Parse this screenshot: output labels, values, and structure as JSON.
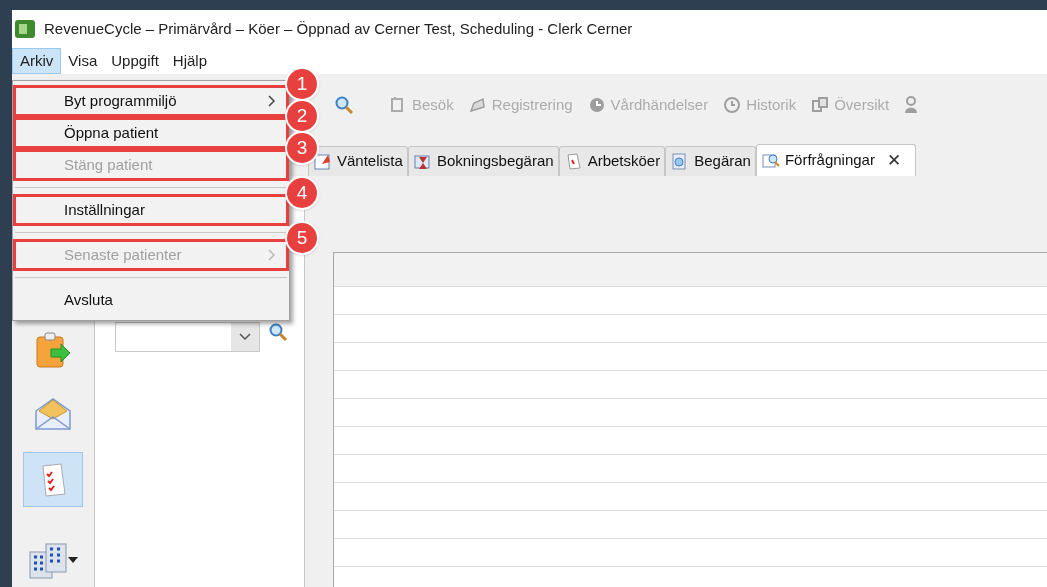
{
  "window": {
    "title": "RevenueCycle – Primärvård – Köer – Öppnad av Cerner Test, Scheduling - Clerk Cerner"
  },
  "menu_bar": [
    {
      "label": "Arkiv",
      "selected": true
    },
    {
      "label": "Visa",
      "selected": false
    },
    {
      "label": "Uppgift",
      "selected": false
    },
    {
      "label": "Hjälp",
      "selected": false
    }
  ],
  "file_menu": [
    {
      "kind": "item",
      "label": "Byt programmiljö",
      "disabled": false,
      "submenu": true,
      "callout": "1"
    },
    {
      "kind": "item",
      "label": "Öppna patient",
      "disabled": false,
      "submenu": false,
      "callout": "2"
    },
    {
      "kind": "item",
      "label": "Stäng patient",
      "disabled": true,
      "submenu": false,
      "callout": "3"
    },
    {
      "kind": "separator"
    },
    {
      "kind": "item",
      "label": "Inställningar",
      "disabled": false,
      "submenu": false,
      "callout": "4"
    },
    {
      "kind": "separator"
    },
    {
      "kind": "item",
      "label": "Senaste patienter",
      "disabled": true,
      "submenu": true,
      "callout": "5"
    },
    {
      "kind": "separator"
    },
    {
      "kind": "item",
      "label": "Avsluta",
      "disabled": false,
      "submenu": false
    }
  ],
  "toolbar": [
    {
      "kind": "visit",
      "label": "Besök",
      "disabled": true
    },
    {
      "kind": "register",
      "label": "Registrering",
      "disabled": true
    },
    {
      "kind": "events",
      "label": "Vårdhändelser",
      "disabled": true
    },
    {
      "kind": "history",
      "label": "Historik",
      "disabled": true
    },
    {
      "kind": "overview",
      "label": "Översikt",
      "disabled": true
    },
    {
      "kind": "person",
      "disabled": true
    }
  ],
  "tabs": [
    {
      "label": "Väntelista",
      "selected": false,
      "closable": false
    },
    {
      "label": "Bokningsbegäran",
      "selected": false,
      "closable": false
    },
    {
      "label": "Arbetsköer",
      "selected": false,
      "closable": false
    },
    {
      "label": "Begäran",
      "selected": false,
      "closable": false
    },
    {
      "label": "Förfrågningar",
      "selected": true,
      "closable": true,
      "close": "✕"
    }
  ],
  "rail": [
    {
      "kind": "clipboard",
      "selected": false
    },
    {
      "kind": "envelope",
      "selected": false
    },
    {
      "kind": "checklist",
      "selected": true
    },
    {
      "kind": "buildings",
      "selected": false
    }
  ]
}
